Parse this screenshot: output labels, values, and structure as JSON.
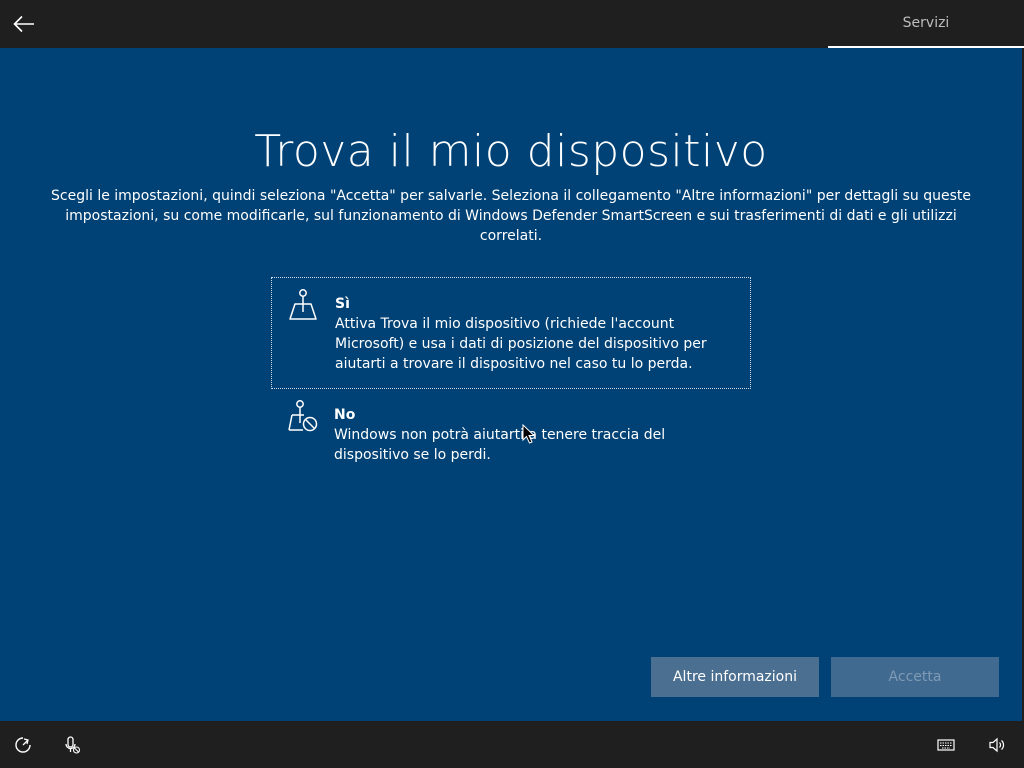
{
  "header": {
    "section_label": "Servizi"
  },
  "main": {
    "title": "Trova il mio dispositivo",
    "subtitle": "Scegli le impostazioni, quindi seleziona \"Accetta\" per salvarle. Seleziona il collegamento \"Altre informazioni\" per dettagli su queste impostazioni, su come modificarle, sul funzionamento di Windows Defender SmartScreen e sui trasferimenti di dati e gli utilizzi correlati.",
    "options": [
      {
        "title": "Sì",
        "description": "Attiva Trova il mio dispositivo (richiede l'account Microsoft) e usa i dati di posizione del dispositivo per aiutarti a trovare il dispositivo nel caso tu lo perda.",
        "icon": "map-pin-icon",
        "selected": true
      },
      {
        "title": "No",
        "description": "Windows non potrà aiutarti a tenere traccia del dispositivo se lo perdi.",
        "icon": "map-pin-blocked-icon",
        "selected": false
      }
    ]
  },
  "buttons": {
    "more_info": "Altre informazioni",
    "accept": "Accetta"
  },
  "taskbar": {
    "icons": [
      "ease-of-access-icon",
      "microphone-off-icon",
      "keyboard-icon",
      "volume-icon"
    ]
  },
  "colors": {
    "background": "#004275",
    "bars": "#1f1f1f",
    "button_primary": "#4b6f91",
    "button_disabled": "#416a91"
  }
}
